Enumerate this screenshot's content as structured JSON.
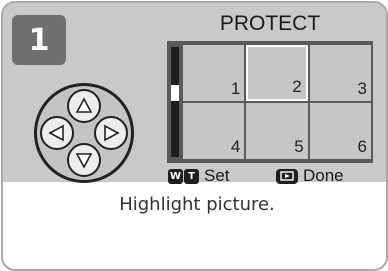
{
  "step": {
    "number": "1"
  },
  "dpad": {
    "icon": "four-way-dpad-icon"
  },
  "screen": {
    "title": "PROTECT",
    "thumbnails": [
      "1",
      "2",
      "3",
      "4",
      "5",
      "6"
    ],
    "selected_thumbnail": "2",
    "scroll_position": 0.4
  },
  "help": {
    "set": {
      "keys": [
        "W",
        "T"
      ],
      "label": "Set"
    },
    "done": {
      "key_icon": "playback-button-icon",
      "label": "Done"
    }
  },
  "caption": "Highlight picture.",
  "colors": {
    "panel": "#c9c9c9",
    "badge": "#6f6f6f",
    "thumb_bg": "#5a5a5a",
    "thumb": "#c6c6c6"
  }
}
